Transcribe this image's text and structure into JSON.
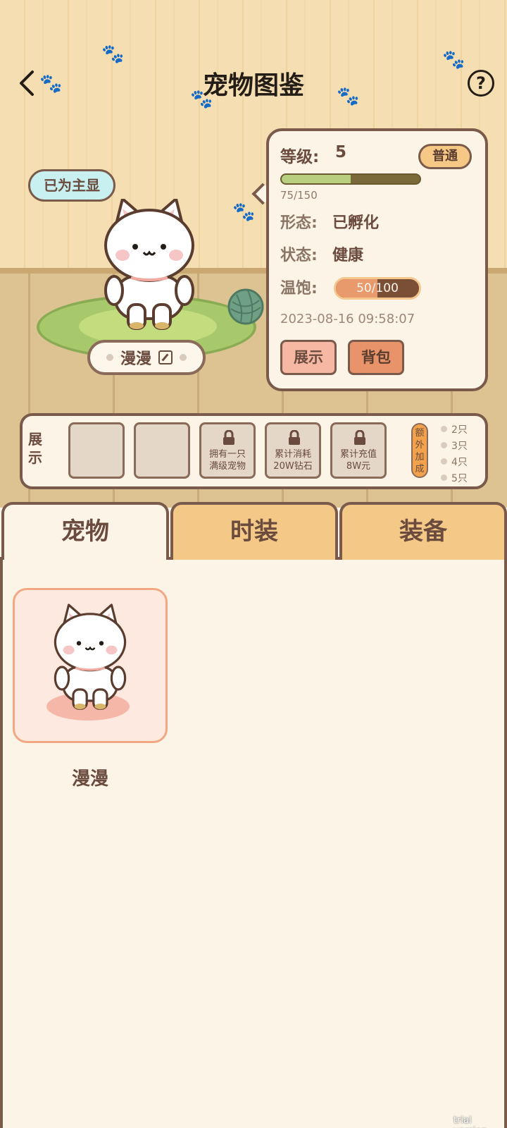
{
  "header": {
    "title": "宠物图鉴"
  },
  "pet_display": {
    "main_badge": "已为主显",
    "pet_name": "漫漫"
  },
  "info_card": {
    "level_label": "等级:",
    "level_value": "5",
    "rarity": "普通",
    "exp_current": 75,
    "exp_max": 150,
    "exp_text": "75/150",
    "form_label": "形态:",
    "form_value": "已孵化",
    "status_label": "状态:",
    "status_value": "健康",
    "satiety_label": "温饱:",
    "satiety_current": 50,
    "satiety_max": 100,
    "satiety_text": "50/100",
    "timestamp": "2023-08-16 09:58:07",
    "show_button": "展示",
    "bag_button": "背包"
  },
  "display_bar": {
    "label": "展示",
    "locked_slots": [
      {
        "line1": "拥有一只",
        "line2": "满级宠物"
      },
      {
        "line1": "累计消耗",
        "line2": "20W钻石"
      },
      {
        "line1": "累计充值",
        "line2": "8W元"
      }
    ],
    "bonus_tag": "额外加成",
    "bonus_levels": [
      "2只",
      "3只",
      "4只",
      "5只"
    ]
  },
  "tabs": [
    {
      "label": "宠物",
      "active": true
    },
    {
      "label": "时装",
      "active": false
    },
    {
      "label": "装备",
      "active": false
    }
  ],
  "pet_list": [
    {
      "name": "漫漫"
    }
  ],
  "watermark": "trial version",
  "colors": {
    "wall": "#f5dfb2",
    "floor": "#dcc391",
    "border": "#7a5a4a",
    "panel": "#fcf4e6",
    "tab_idle": "#f4c988"
  }
}
